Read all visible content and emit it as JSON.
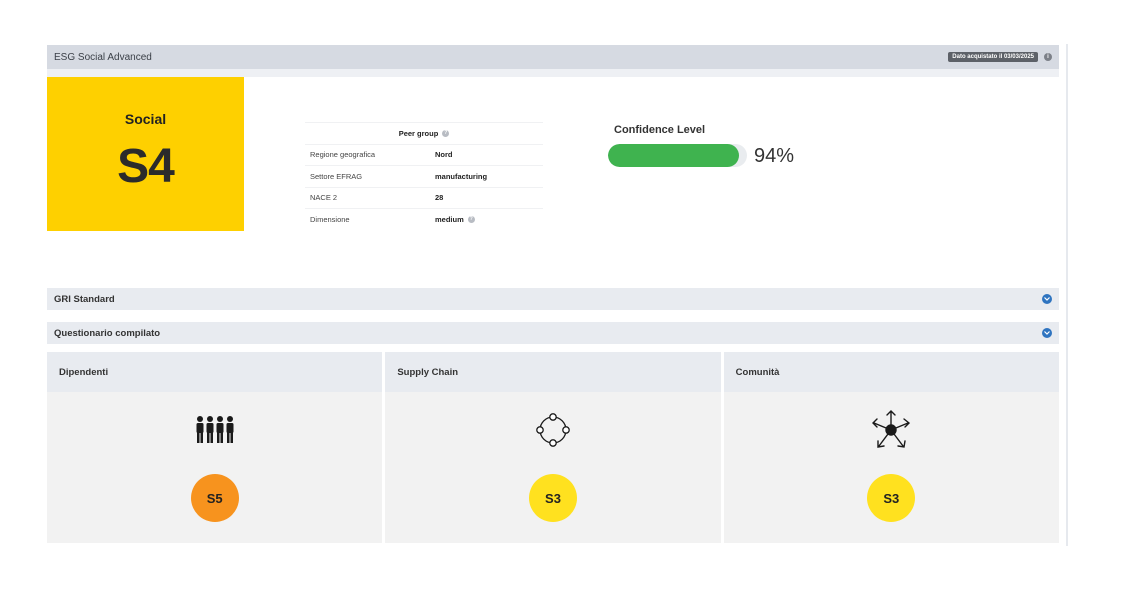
{
  "header": {
    "title": "ESG Social Advanced",
    "date_badge": "Dato acquistato il 03/03/2025"
  },
  "score": {
    "label": "Social",
    "value": "S4",
    "color": "#FED000"
  },
  "peer_group": {
    "title": "Peer group",
    "rows": [
      {
        "key": "Regione geografica",
        "value": "Nord"
      },
      {
        "key": "Settore EFRAG",
        "value": "manufacturing"
      },
      {
        "key": "NACE 2",
        "value": "28"
      },
      {
        "key": "Dimensione",
        "value": "medium"
      }
    ]
  },
  "confidence": {
    "title": "Confidence Level",
    "percent_label": "94%",
    "value": 0.94,
    "bar_color": "#3FB34F"
  },
  "sections": {
    "gri": "GRI Standard",
    "questionario": "Questionario compilato"
  },
  "cards": [
    {
      "title": "Dipendenti",
      "icon": "people-group-icon",
      "score": "S5",
      "score_color": "#F7931E"
    },
    {
      "title": "Supply Chain",
      "icon": "supply-chain-cycle-icon",
      "score": "S3",
      "score_color": "#FFE11F"
    },
    {
      "title": "Comunità",
      "icon": "community-hands-icon",
      "score": "S3",
      "score_color": "#FFE11F"
    }
  ]
}
